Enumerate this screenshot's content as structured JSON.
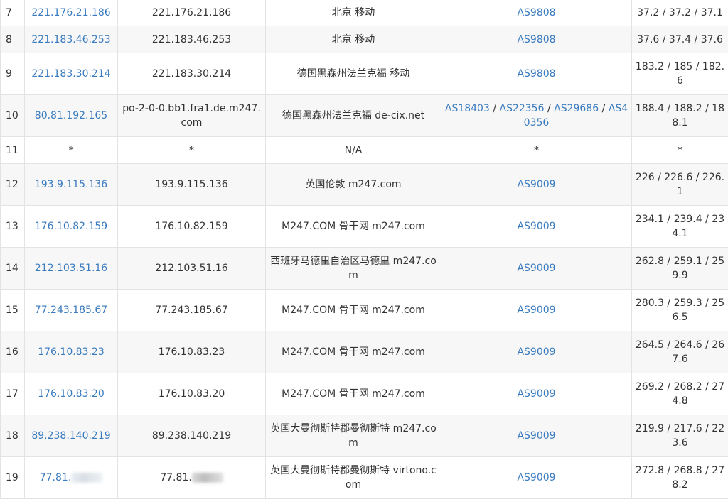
{
  "rows": [
    {
      "hop": "7",
      "ip": "221.176.21.186",
      "host": "221.176.21.186",
      "location": "北京 移动",
      "as": [
        "AS9808"
      ],
      "latency": "37.2 / 37.2 / 37.1"
    },
    {
      "hop": "8",
      "ip": "221.183.46.253",
      "host": "221.183.46.253",
      "location": "北京 移动",
      "as": [
        "AS9808"
      ],
      "latency": "37.6 / 37.4 / 37.6"
    },
    {
      "hop": "9",
      "ip": "221.183.30.214",
      "host": "221.183.30.214",
      "location": "德国黑森州法兰克福 移动",
      "as": [
        "AS9808"
      ],
      "latency": "183.2 / 185 / 182.6"
    },
    {
      "hop": "10",
      "ip": "80.81.192.165",
      "host": "po-2-0-0.bb1.fra1.de.m247.com",
      "location": "德国黑森州法兰克福 de-cix.net",
      "as": [
        "AS18403",
        "AS22356",
        "AS29686",
        "AS40356"
      ],
      "latency": "188.4 / 188.2 / 188.1"
    },
    {
      "hop": "11",
      "ip": "*",
      "host": "*",
      "location": "N/A",
      "as_text": "*",
      "latency": "*"
    },
    {
      "hop": "12",
      "ip": "193.9.115.136",
      "host": "193.9.115.136",
      "location": "英国伦敦 m247.com",
      "as": [
        "AS9009"
      ],
      "latency": "226 / 226.6 / 226.1"
    },
    {
      "hop": "13",
      "ip": "176.10.82.159",
      "host": "176.10.82.159",
      "location": "M247.COM 骨干网 m247.com",
      "as": [
        "AS9009"
      ],
      "latency": "234.1 / 239.4 / 234.1"
    },
    {
      "hop": "14",
      "ip": "212.103.51.16",
      "host": "212.103.51.16",
      "location": "西班牙马德里自治区马德里 m247.com",
      "as": [
        "AS9009"
      ],
      "latency": "262.8 / 259.1 / 259.9"
    },
    {
      "hop": "15",
      "ip": "77.243.185.67",
      "host": "77.243.185.67",
      "location": "M247.COM 骨干网 m247.com",
      "as": [
        "AS9009"
      ],
      "latency": "280.3 / 259.3 / 256.5"
    },
    {
      "hop": "16",
      "ip": "176.10.83.23",
      "host": "176.10.83.23",
      "location": "M247.COM 骨干网 m247.com",
      "as": [
        "AS9009"
      ],
      "latency": "264.5 / 264.6 / 267.6"
    },
    {
      "hop": "17",
      "ip": "176.10.83.20",
      "host": "176.10.83.20",
      "location": "M247.COM 骨干网 m247.com",
      "as": [
        "AS9009"
      ],
      "latency": "269.2 / 268.2 / 274.8"
    },
    {
      "hop": "18",
      "ip": "89.238.140.219",
      "host": "89.238.140.219",
      "location": "英国大曼彻斯特郡曼彻斯特 m247.com",
      "as": [
        "AS9009"
      ],
      "latency": "219.9 / 217.6 / 223.6"
    },
    {
      "hop": "19",
      "ip": "77.81.",
      "ip_redacted": true,
      "host": "77.81.",
      "host_redacted": true,
      "location": "英国大曼彻斯特郡曼彻斯特 virtono.com",
      "as": [
        "AS9009"
      ],
      "latency": "272.8 / 268.8 / 278.2"
    }
  ],
  "colors": {
    "link": "#3a7bbf",
    "text": "#333333",
    "border": "#e3e3e3",
    "stripe": "#f7f7f7"
  }
}
